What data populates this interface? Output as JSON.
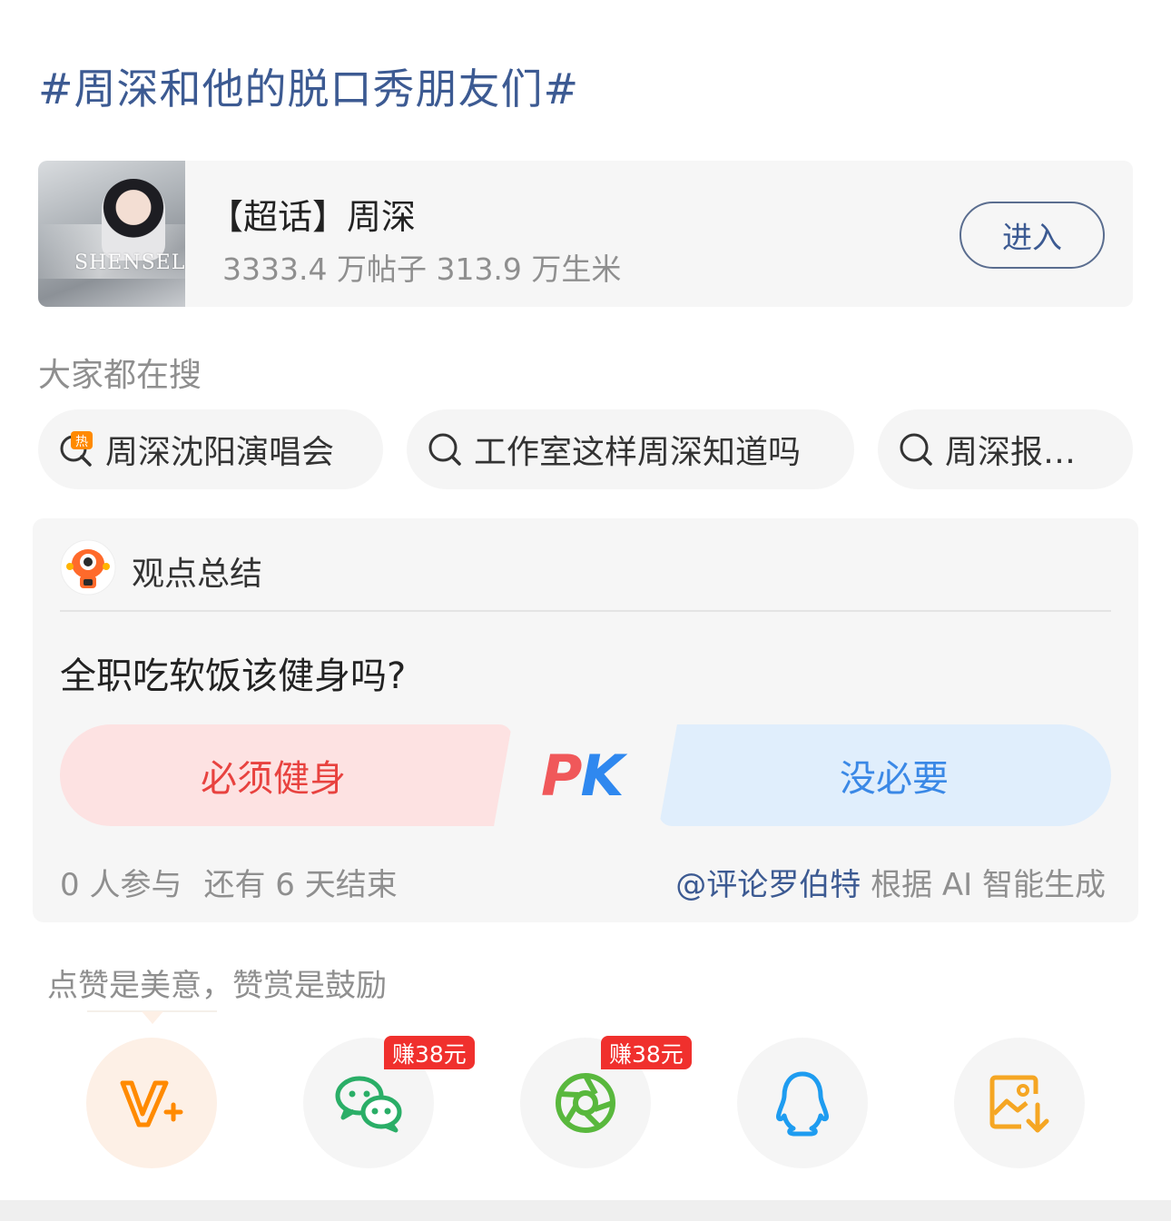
{
  "topic": {
    "title": "#周深和他的脱口秀朋友们#"
  },
  "super_topic": {
    "cover_text": "SHENSELF",
    "name": "【超话】周深",
    "stats": "3333.4 万帖子 313.9 万生米",
    "enter_label": "进入"
  },
  "search": {
    "heading": "大家都在搜",
    "chips": [
      {
        "label": "周深沈阳演唱会",
        "icon": "hot-search-icon"
      },
      {
        "label": "工作室这样周深知道吗",
        "icon": "search-icon"
      },
      {
        "label": "周深报…",
        "icon": "search-icon"
      }
    ]
  },
  "opinion": {
    "heading": "观点总结",
    "question": "全职吃软饭该健身吗?",
    "option_left": "必须健身",
    "option_right": "没必要",
    "pk_p": "P",
    "pk_k": "K",
    "participants": "0 人参与",
    "remaining": "还有 6 天结束",
    "mention": "@评论罗伯特",
    "ai_note": " 根据 AI 智能生成"
  },
  "reward": {
    "text": "点赞是美意，赞赏是鼓励"
  },
  "share": {
    "items": [
      {
        "icon": "v-plus-icon"
      },
      {
        "icon": "wechat-icon",
        "badge": "赚38元"
      },
      {
        "icon": "moments-icon",
        "badge": "赚38元"
      },
      {
        "icon": "qq-icon"
      },
      {
        "icon": "save-image-icon"
      }
    ]
  },
  "colors": {
    "link_blue": "#3c5a92",
    "red": "#e8423f",
    "blue": "#3a88e6",
    "orange": "#ff8a00",
    "wechat_green": "#2aae67",
    "moments_green": "#59b83d",
    "qq_blue": "#1e9cf0",
    "save_orange": "#f5a623"
  }
}
